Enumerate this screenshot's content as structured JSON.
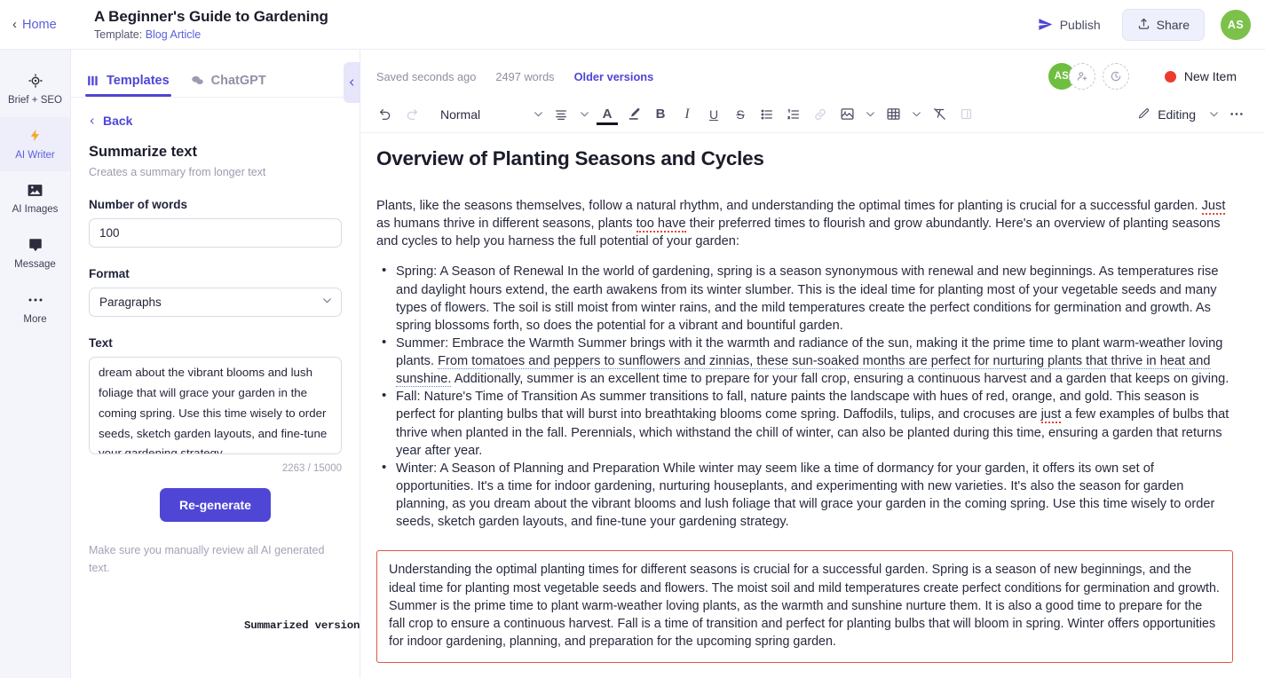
{
  "header": {
    "home_label": "Home",
    "doc_title": "A Beginner's Guide to Gardening",
    "template_prefix": "Template:",
    "template_name": "Blog Article",
    "publish_label": "Publish",
    "share_label": "Share",
    "avatar_initials": "AS",
    "avatar_color": "#7cc14a"
  },
  "rail": {
    "items": [
      {
        "label": "Brief + SEO",
        "icon": "target-icon",
        "active": false
      },
      {
        "label": "AI Writer",
        "icon": "lightning-icon",
        "active": true
      },
      {
        "label": "AI Images",
        "icon": "image-icon",
        "active": false
      },
      {
        "label": "Message",
        "icon": "chat-icon",
        "active": false
      },
      {
        "label": "More",
        "icon": "ellipsis-icon",
        "active": false
      }
    ]
  },
  "panel": {
    "tabs": [
      {
        "label": "Templates",
        "icon": "grid-icon",
        "active": true
      },
      {
        "label": "ChatGPT",
        "icon": "chat-bubbles-icon",
        "active": false
      }
    ],
    "back_label": "Back",
    "tool_name": "Summarize text",
    "tool_desc": "Creates a summary from longer text",
    "fields": {
      "words_label": "Number of words",
      "words_value": "100",
      "format_label": "Format",
      "format_value": "Paragraphs",
      "format_options": [
        "Paragraphs"
      ],
      "text_label": "Text",
      "text_value": "dream about the vibrant blooms and lush foliage that will grace your garden in the coming spring. Use this time wisely to order seeds, sketch garden layouts, and fine-tune your gardening strategy.",
      "char_count": "2263 / 15000"
    },
    "regenerate_label": "Re-generate",
    "disclaimer": "Make sure you manually review all AI generated text.",
    "gutter_label": "Summarized version"
  },
  "editor": {
    "status": {
      "saved": "Saved seconds ago",
      "words": "2497 words",
      "older_versions": "Older versions",
      "collab_initials": "AS",
      "collab_color": "#6ebe3f",
      "new_item_label": "New Item",
      "new_item_color": "#ed3b2f"
    },
    "toolbar": {
      "style_value": "Normal",
      "editing_label": "Editing"
    },
    "document": {
      "heading": "Overview of Planting Seasons and Cycles",
      "intro_parts": [
        "Plants, like the seasons themselves, follow a natural rhythm, and understanding the optimal times for planting is crucial for a successful garden. ",
        "Just",
        " as humans thrive in different seasons, plants ",
        "too have",
        " their preferred times to flourish and grow abundantly. Here's an overview of planting seasons and cycles to help you harness the full potential of your garden:"
      ],
      "bullets": [
        {
          "parts": [
            {
              "t": "Spring: A Season of Renewal In the world of gardening, spring is a season synonymous with renewal and new beginnings. As temperatures rise and daylight hours extend, the earth awakens from its winter slumber. This is the ideal time for planting most of your vegetable seeds and many types of flowers. The soil is still moist from winter rains, and the mild temperatures create the perfect conditions for germination and growth. As spring blossoms forth, so does the potential for a vibrant and bountiful garden.",
              "mark": "none"
            }
          ]
        },
        {
          "parts": [
            {
              "t": "Summer: Embrace the Warmth Summer brings with it the warmth and radiance of the sun, making it the prime time to plant warm-weather loving plants. ",
              "mark": "none"
            },
            {
              "t": "From tomatoes and peppers to sunflowers and zinnias, these sun-soaked months are perfect for nurturing plants that thrive in heat and sunshine.",
              "mark": "ai"
            },
            {
              "t": " Additionally, summer is an excellent time to prepare for your fall crop, ensuring a continuous harvest and a garden that keeps on giving.",
              "mark": "none"
            }
          ]
        },
        {
          "parts": [
            {
              "t": "Fall: Nature's Time of Transition As summer transitions to fall, nature paints the landscape with hues of red, orange, and gold. This season is perfect for planting bulbs that will burst into breathtaking blooms come spring. Daffodils, tulips, and crocuses are ",
              "mark": "none"
            },
            {
              "t": "just",
              "mark": "spell"
            },
            {
              "t": " a few examples of bulbs that thrive when planted in the fall. Perennials, which withstand the chill of winter, can also be planted during this time, ensuring a garden that returns year after year.",
              "mark": "none"
            }
          ]
        },
        {
          "parts": [
            {
              "t": "Winter: A Season of Planning and Preparation While winter may seem like a time of dormancy for your garden, it offers its own set of opportunities. It's a time for indoor gardening, nurturing houseplants, and experimenting with new varieties. It's also the season for garden planning, as you dream about the vibrant blooms and lush foliage that will grace your garden in the coming spring. Use this time wisely to order seeds, sketch garden layouts, and fine-tune your gardening strategy.",
              "mark": "none"
            }
          ]
        }
      ],
      "summary_text": "Understanding the optimal planting times for different seasons is crucial for a successful garden. Spring is a season of new beginnings, and the ideal time for planting most vegetable seeds and flowers. The moist soil and mild temperatures create perfect conditions for germination and growth. Summer is the prime time to plant warm-weather loving plants, as the warmth and sunshine nurture them. It is also a good time to prepare for the fall crop to ensure a continuous harvest. Fall is a time of transition and perfect for planting bulbs that will bloom in spring. Winter offers opportunities for indoor gardening, planning, and preparation for the upcoming spring garden.",
      "summary_border_color": "#e2564b"
    }
  }
}
